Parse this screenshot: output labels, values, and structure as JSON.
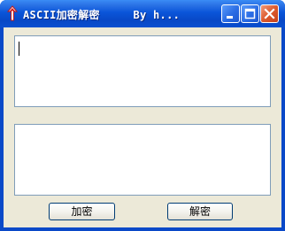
{
  "window": {
    "title": "ASCII加密解密     By h...",
    "icon": "arrow-up-icon",
    "controls": [
      "minimize-icon",
      "maximize-icon",
      "close-icon"
    ]
  },
  "input_box": {
    "value": ""
  },
  "output_box": {
    "value": ""
  },
  "buttons": {
    "encrypt_label": "加密",
    "decrypt_label": "解密"
  },
  "colors": {
    "titlebar": "#0a55d9",
    "client": "#ece9d8",
    "close_button": "#dc5a2e",
    "textbox_border": "#7f9db9"
  }
}
